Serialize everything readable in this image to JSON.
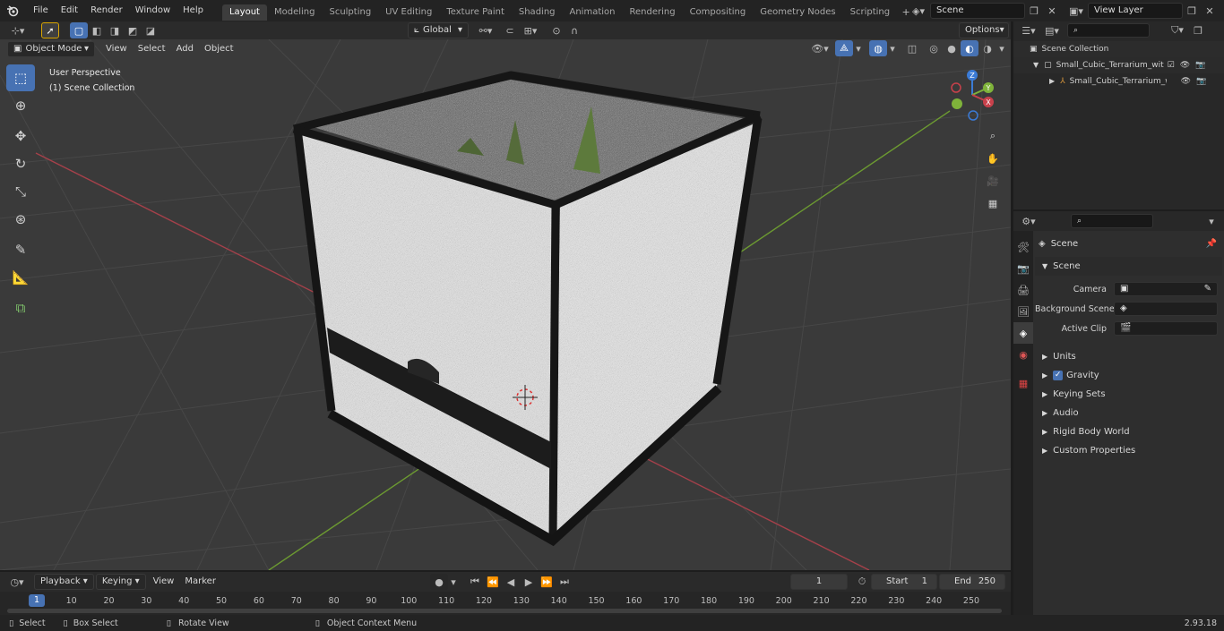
{
  "topbar": {
    "menus": [
      "File",
      "Edit",
      "Render",
      "Window",
      "Help"
    ],
    "workspace_tabs": [
      "Layout",
      "Modeling",
      "Sculpting",
      "UV Editing",
      "Texture Paint",
      "Shading",
      "Animation",
      "Rendering",
      "Compositing",
      "Geometry Nodes",
      "Scripting"
    ],
    "active_tab": "Layout",
    "scene_name": "Scene",
    "view_layer": "View Layer"
  },
  "viewport_header": {
    "mode": "Object Mode",
    "menus": [
      "View",
      "Select",
      "Add",
      "Object"
    ],
    "transform_orientation": "Global",
    "options_label": "Options"
  },
  "viewport": {
    "perspective_label": "User Perspective",
    "collection_label": "(1) Scene Collection",
    "gizmo_axes": [
      "X",
      "Y",
      "Z"
    ]
  },
  "outliner": {
    "root": "Scene Collection",
    "items": [
      {
        "label": "Small_Cubic_Terrarium_with_I"
      },
      {
        "label": "Small_Cubic_Terrarium_w"
      }
    ]
  },
  "properties": {
    "context_title": "Scene",
    "scene_panel": {
      "title": "Scene",
      "camera_label": "Camera",
      "background_scene_label": "Background Scene",
      "active_clip_label": "Active Clip"
    },
    "collapsed_panels": [
      "Units",
      "Gravity",
      "Keying Sets",
      "Audio",
      "Rigid Body World",
      "Custom Properties"
    ],
    "gravity_checked": true
  },
  "timeline": {
    "menus": [
      "Playback",
      "Keying",
      "View",
      "Marker"
    ],
    "current_frame": "1",
    "start_label": "Start",
    "start_value": "1",
    "end_label": "End",
    "end_value": "250",
    "ticks": [
      "1",
      "10",
      "20",
      "30",
      "40",
      "50",
      "60",
      "70",
      "80",
      "90",
      "100",
      "110",
      "120",
      "130",
      "140",
      "150",
      "160",
      "170",
      "180",
      "190",
      "200",
      "210",
      "220",
      "230",
      "240",
      "250"
    ]
  },
  "statusbar": {
    "select": "Select",
    "box_select": "Box Select",
    "rotate_view": "Rotate View",
    "context_menu": "Object Context Menu",
    "version": "2.93.18"
  },
  "colors": {
    "accent": "#4772b3",
    "x_axis": "#c8414b",
    "y_axis": "#7fb33a",
    "z_axis": "#3b7bd6"
  }
}
